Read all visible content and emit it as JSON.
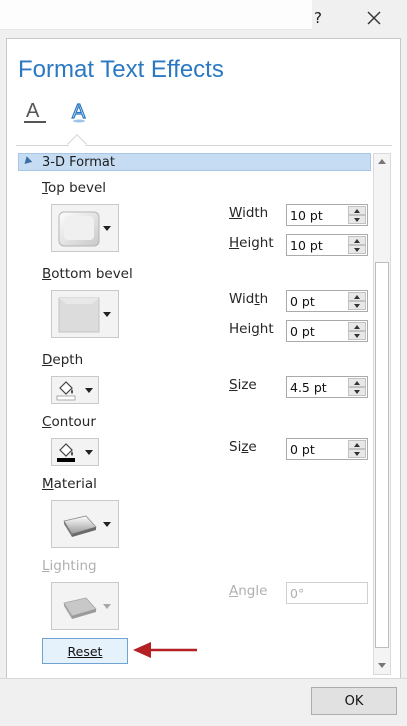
{
  "window": {
    "help_label": "?",
    "close_icon": "close-icon"
  },
  "pane": {
    "title": "Format Text Effects",
    "tabs": [
      {
        "name": "text-fill-outline",
        "icon": "text-fill-outline-icon"
      },
      {
        "name": "text-effects",
        "icon": "text-effects-icon",
        "selected": true
      }
    ]
  },
  "section": {
    "label": "3-D Format",
    "expanded": true
  },
  "top_bevel": {
    "label_key": "T",
    "label_rest": "op bevel",
    "width_label_key": "W",
    "width_label_rest": "idth",
    "width_value": "10 pt",
    "height_label_key": "H",
    "height_label_rest": "eight",
    "height_value": "10 pt"
  },
  "bottom_bevel": {
    "label_key": "B",
    "label_rest": "ottom bevel",
    "width_label_pre": "Wid",
    "width_label_key": "t",
    "width_label_rest": "h",
    "width_value": "0 pt",
    "height_label_pre": "Hei",
    "height_label_key": "g",
    "height_label_rest": "ht",
    "height_value": "0 pt"
  },
  "depth": {
    "label_pre": "",
    "label_key": "D",
    "label_rest": "epth",
    "size_label_key": "S",
    "size_label_rest": "ize",
    "size_value": "4.5 pt"
  },
  "contour": {
    "label_key": "C",
    "label_rest": "ontour",
    "size_label_pre": "Si",
    "size_label_key": "z",
    "size_label_rest": "e",
    "size_value": "0 pt"
  },
  "material": {
    "label_key": "M",
    "label_rest": "aterial"
  },
  "lighting": {
    "label_key": "L",
    "label_rest": "ighting",
    "angle_label_key": "A",
    "angle_label_rest": "ngle",
    "angle_value": "0°",
    "disabled": true
  },
  "reset_label": "Reset",
  "ok_label": "OK",
  "colors": {
    "accent": "#2b79c2",
    "section_header": "#c6dcf2",
    "annotation_arrow": "#b52025"
  }
}
